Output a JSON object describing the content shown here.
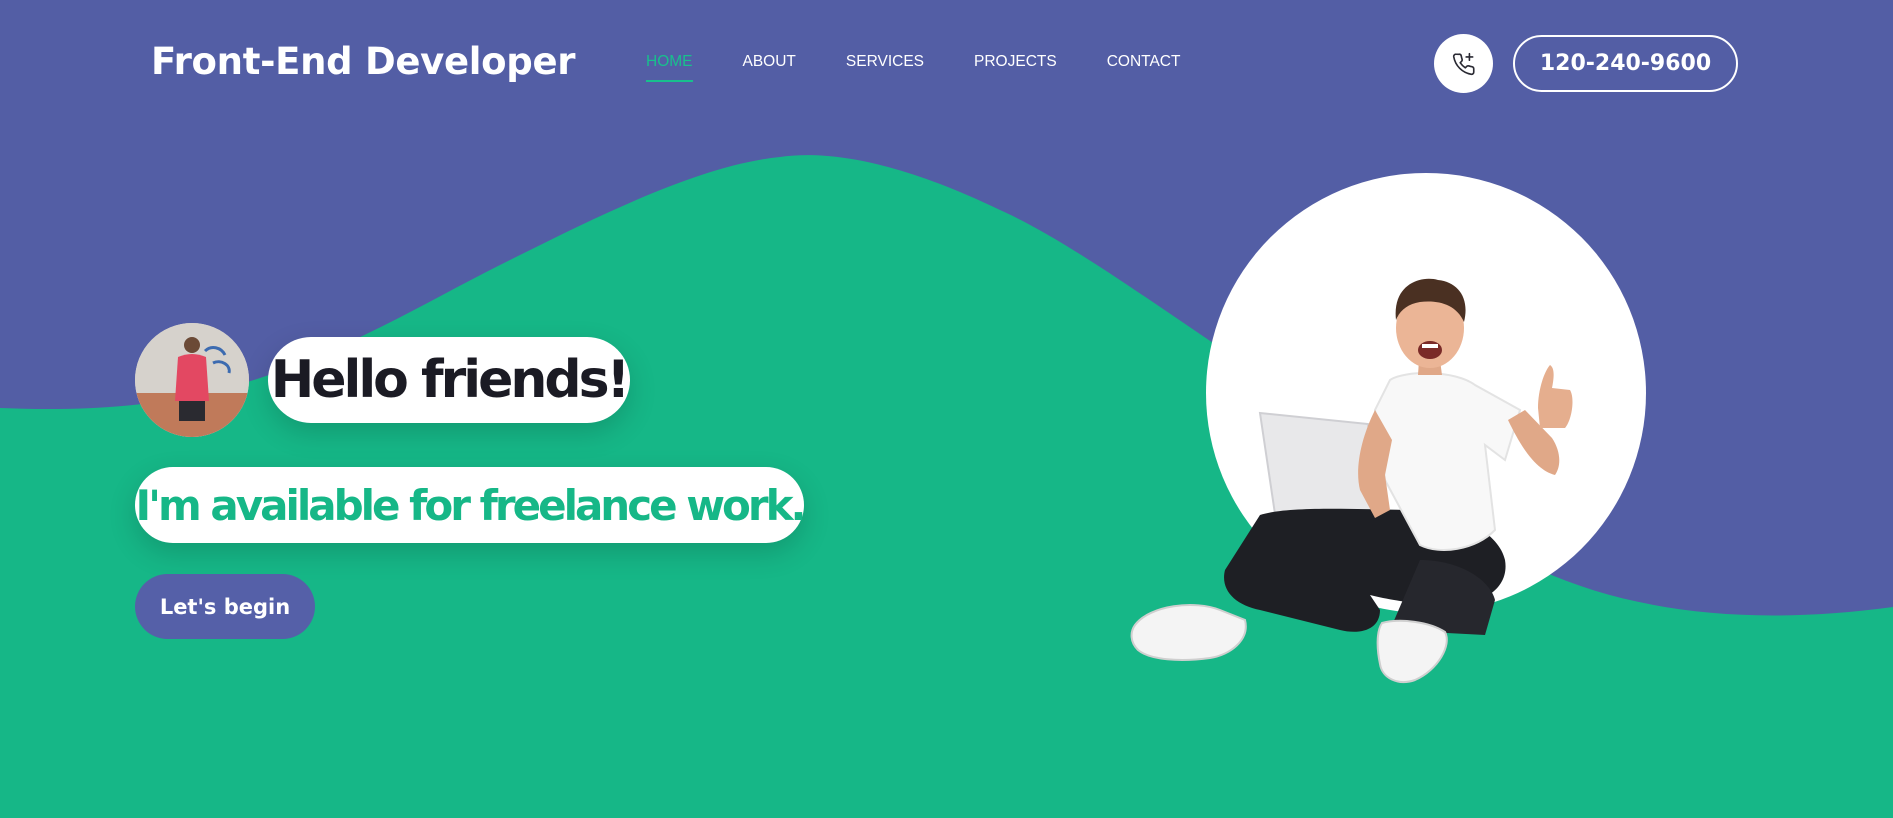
{
  "header": {
    "brand": "Front-End Developer",
    "nav": [
      {
        "label": "HOME",
        "active": true
      },
      {
        "label": "ABOUT",
        "active": false
      },
      {
        "label": "SERVICES",
        "active": false
      },
      {
        "label": "PROJECTS",
        "active": false
      },
      {
        "label": "CONTACT",
        "active": false
      }
    ],
    "phone_icon": "phone-plus-icon",
    "phone_number": "120-240-9600"
  },
  "hero": {
    "greeting": "Hello friends!",
    "tagline": "I'm available for freelance work.",
    "cta_label": "Let's begin"
  },
  "colors": {
    "purple": "#535ea5",
    "green": "#16b787",
    "white": "#ffffff",
    "dark_text": "#1b1b24"
  }
}
